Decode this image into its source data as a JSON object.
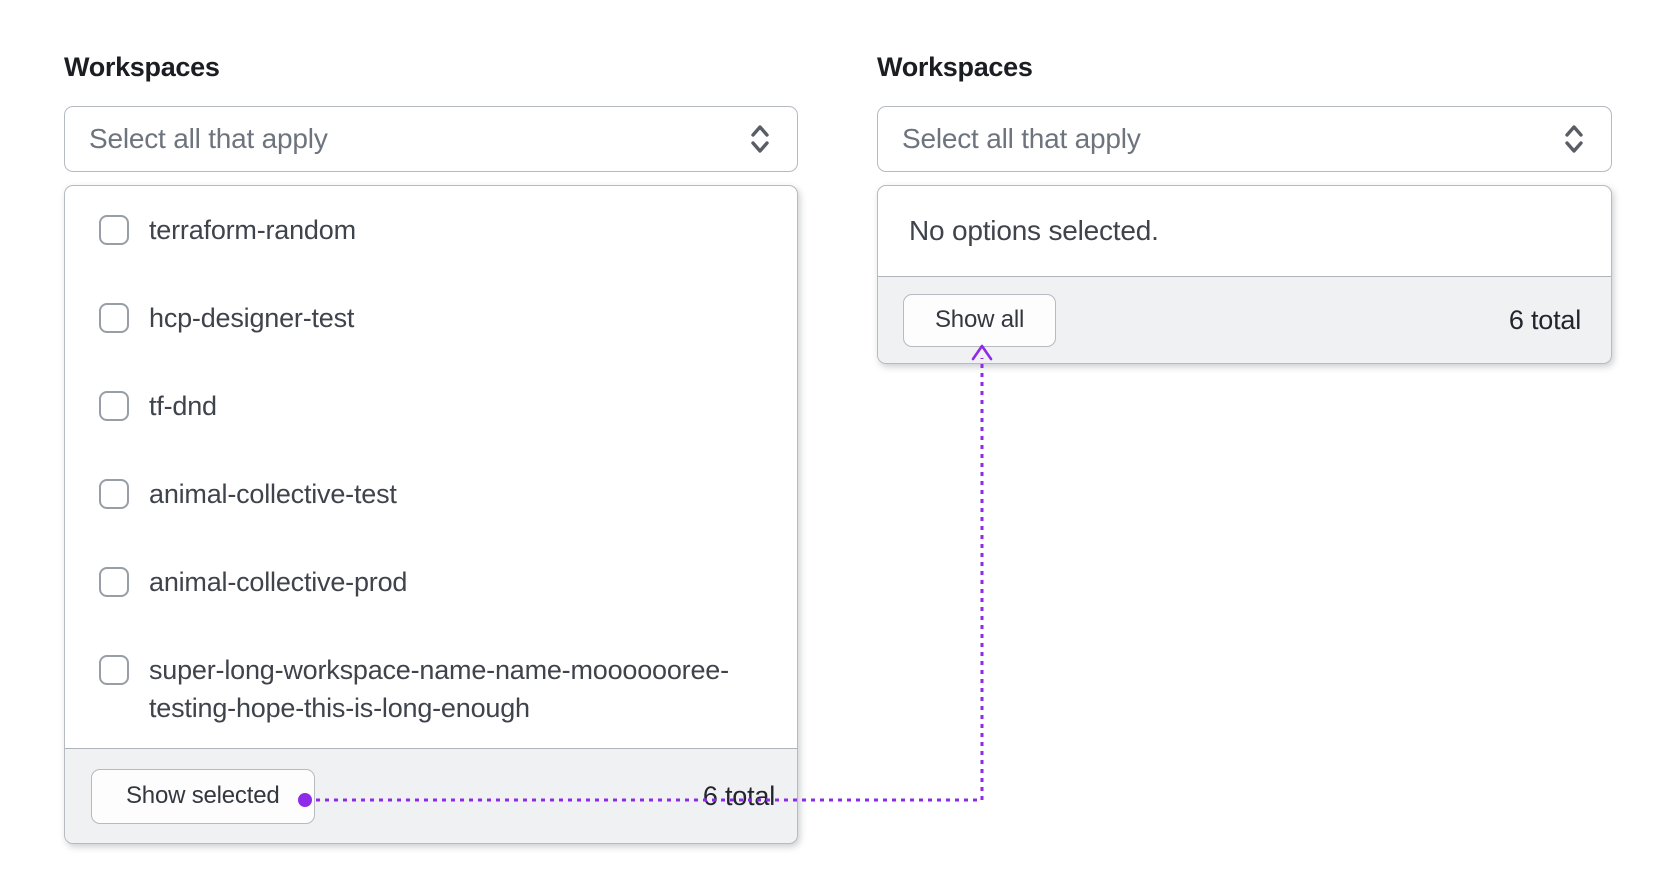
{
  "colors": {
    "annotation_purple": "#8E2BE8",
    "panel_border": "#B6BAC1",
    "footer_background": "#F0F1F3"
  },
  "left_combobox": {
    "label": "Workspaces",
    "trigger": {
      "placeholder": "Select all that apply",
      "caret_icon": "caret-up-down-icon"
    },
    "options": [
      "terraform-random",
      "hcp-designer-test",
      "tf-dnd",
      "animal-collective-test",
      "animal-collective-prod",
      "super-long-workspace-name-name-mooooooree-testing-hope-this-is-long-enough"
    ],
    "footer": {
      "button_label": "Show selected",
      "total_label": "6 total"
    }
  },
  "right_combobox": {
    "label": "Workspaces",
    "trigger": {
      "placeholder": "Select all that apply",
      "caret_icon": "caret-up-down-icon"
    },
    "empty_message": "No options selected.",
    "footer": {
      "button_label": "Show all",
      "total_label": "6 total"
    }
  }
}
